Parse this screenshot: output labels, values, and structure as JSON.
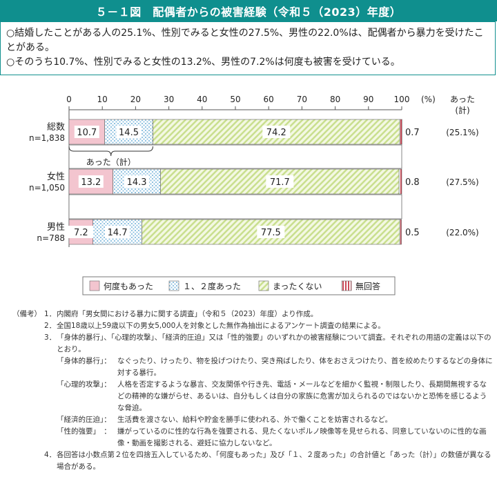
{
  "title": "５－１図　配偶者からの被害経験（令和５（2023）年度）",
  "summary": [
    "○結婚したことがある人の25.1%、性別でみると女性の27.5%、男性の22.0%は、配偶者から暴力を受けたことがある。",
    "○そのうち10.7%、性別でみると女性の13.2%、男性の7.2%は何度も被害を受けている。"
  ],
  "colors": {
    "accent": "#0f8f8e",
    "many": "#f3c5cf",
    "once": "#a9cfe6",
    "never": "#dcebb3",
    "noans": "#c94a57"
  },
  "chart_data": {
    "type": "bar",
    "orientation": "horizontal",
    "stacked": true,
    "xlim": [
      0,
      100
    ],
    "xticks": [
      0,
      10,
      20,
      30,
      40,
      50,
      60,
      70,
      80,
      90,
      100
    ],
    "unit_label": "(%)",
    "right_header": [
      "あった",
      "(計)"
    ],
    "categories": [
      {
        "label": "総数",
        "n": "n=1,838",
        "total": "(25.1%)"
      },
      {
        "label": "女性",
        "n": "n=1,050",
        "total": "(27.5%)"
      },
      {
        "label": "男性",
        "n": "n=788",
        "total": "(22.0%)"
      }
    ],
    "series": [
      {
        "name": "何度もあった",
        "values": [
          10.7,
          13.2,
          7.2
        ]
      },
      {
        "name": "１、２度あった",
        "values": [
          14.5,
          14.3,
          14.7
        ]
      },
      {
        "name": "まったくない",
        "values": [
          74.2,
          71.7,
          77.5
        ]
      },
      {
        "name": "無回答",
        "values": [
          0.7,
          0.8,
          0.5
        ]
      }
    ],
    "annotation": "あった（計）",
    "legend_position": "bottom"
  },
  "notes": {
    "head": "（備考）",
    "items": [
      {
        "num": "1．",
        "text": "内閣府「男女間における暴力に関する調査」（令和５（2023）年度）より作成。"
      },
      {
        "num": "2．",
        "text": "全国18歳以上59歳以下の男女5,000人を対象とした無作為抽出によるアンケート調査の結果による。"
      },
      {
        "num": "3．",
        "text": "「身体的暴行」、「心理的攻撃」、「経済的圧迫」又は「性的強要」のいずれかの被害経験について調査。それぞれの用語の定義は以下のとおり。"
      }
    ],
    "definitions": [
      {
        "key": "「身体的暴行」：",
        "value": "なぐったり、けったり、物を投げつけたり、突き飛ばしたり、体をおさえつけたり、首を絞めたりするなどの身体に対する暴行。"
      },
      {
        "key": "「心理的攻撃」：",
        "value": "人格を否定するような暴言、交友関係や行き先、電話・メールなどを細かく監視・制限したり、長期間無視するなどの精神的な嫌がらせ、あるいは、自分もしくは自分の家族に危害が加えられるのではないかと恐怖を感じるような脅迫。"
      },
      {
        "key": "「経済的圧迫」：",
        "value": "生活費を渡さない、給料や貯金を勝手に使われる、外で働くことを妨害されるなど。"
      },
      {
        "key": "「性的強要」　：",
        "value": "嫌がっているのに性的な行為を強要される、見たくないポルノ映像等を見せられる、同意していないのに性的な画像・動画を撮影される、避妊に協力しないなど。"
      }
    ],
    "last": {
      "num": "4．",
      "text": "各回答は小数点第２位を四捨五入しているため、「何度もあった」及び「１、２度あった」の合計値と「あった（計）」の数値が異なる場合がある。"
    }
  }
}
